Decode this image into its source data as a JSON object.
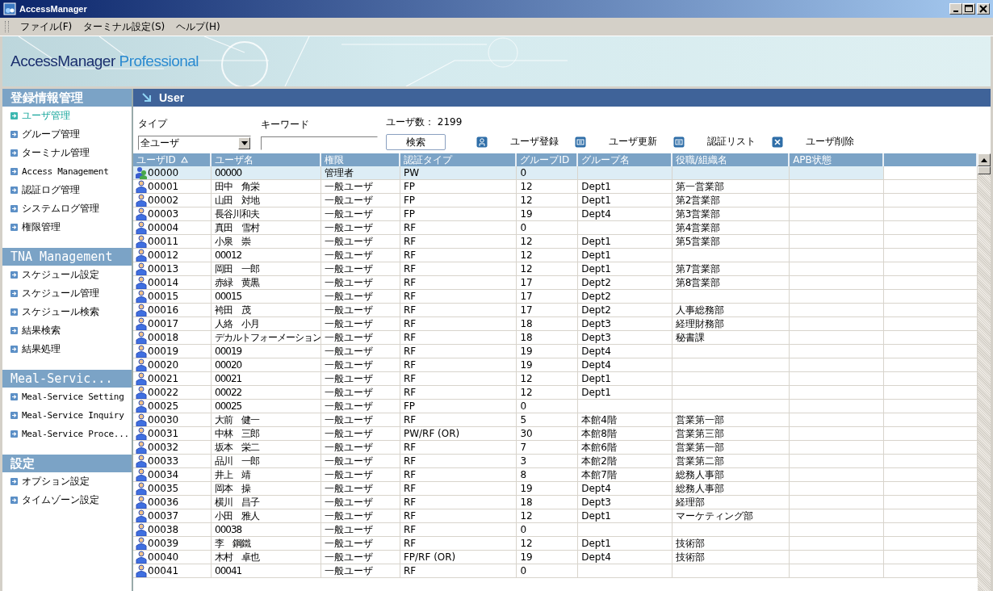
{
  "window": {
    "title": "AccessManager"
  },
  "menu": [
    {
      "label": "ファイル(F)"
    },
    {
      "label": "ターミナル設定(S)"
    },
    {
      "label": "ヘルプ(H)"
    }
  ],
  "banner": {
    "brand": "AccessManager",
    "product": "Professional"
  },
  "sidebar": [
    {
      "title": "登録情報管理",
      "items": [
        {
          "label": "ユーザ管理",
          "selected": true
        },
        {
          "label": "グループ管理",
          "selected": false
        },
        {
          "label": "ターミナル管理",
          "selected": false
        },
        {
          "label": "Access Management",
          "selected": false
        },
        {
          "label": "認証ログ管理",
          "selected": false
        },
        {
          "label": "システムログ管理",
          "selected": false
        },
        {
          "label": "権限管理",
          "selected": false
        }
      ]
    },
    {
      "title": "TNA Management",
      "items": [
        {
          "label": "スケジュール設定",
          "selected": false
        },
        {
          "label": "スケジュール管理",
          "selected": false
        },
        {
          "label": "スケジュール検索",
          "selected": false
        },
        {
          "label": "結果検索",
          "selected": false
        },
        {
          "label": "結果処理",
          "selected": false
        }
      ]
    },
    {
      "title": "Meal-Servic...",
      "items": [
        {
          "label": "Meal-Service Setting",
          "selected": false
        },
        {
          "label": "Meal-Service Inquiry",
          "selected": false
        },
        {
          "label": "Meal-Service Proce...",
          "selected": false
        }
      ]
    },
    {
      "title": "設定",
      "items": [
        {
          "label": "オプション設定",
          "selected": false
        },
        {
          "label": "タイムゾーン設定",
          "selected": false
        }
      ]
    }
  ],
  "panel": {
    "title": "User"
  },
  "filters": {
    "type_label": "タイプ",
    "type_value": "全ユーザ",
    "keyword_label": "キーワード",
    "count_label": "ユーザ数：",
    "count": "2199",
    "search_button": "検索"
  },
  "actions": [
    {
      "kind": "add",
      "label": "ユーザ登録"
    },
    {
      "kind": "update",
      "label": "ユーザ更新"
    },
    {
      "kind": "list",
      "label": "認証リスト"
    },
    {
      "kind": "delete",
      "label": "ユーザ削除"
    }
  ],
  "table": {
    "columns": [
      {
        "label": "ユーザID",
        "sorted": true
      },
      {
        "label": "ユーザ名",
        "sorted": false
      },
      {
        "label": "権限",
        "sorted": false
      },
      {
        "label": "認証タイプ",
        "sorted": false
      },
      {
        "label": "グループID",
        "sorted": false
      },
      {
        "label": "グループ名",
        "sorted": false
      },
      {
        "label": "役職/組織名",
        "sorted": false
      },
      {
        "label": "APB状態",
        "sorted": false
      }
    ],
    "rows": [
      {
        "kind": "admin",
        "selected": true,
        "cells": [
          "00000",
          "00000",
          "管理者",
          "PW",
          "0",
          "",
          ""
        ]
      },
      {
        "kind": "user",
        "selected": false,
        "cells": [
          "00001",
          "田中　角栄",
          "一般ユーザ",
          "FP",
          "12",
          "Dept1",
          "第一営業部"
        ]
      },
      {
        "kind": "user",
        "selected": false,
        "cells": [
          "00002",
          "山田　対地",
          "一般ユーザ",
          "FP",
          "12",
          "Dept1",
          "第2営業部"
        ]
      },
      {
        "kind": "user",
        "selected": false,
        "cells": [
          "00003",
          "長谷川和夫",
          "一般ユーザ",
          "FP",
          "19",
          "Dept4",
          "第3営業部"
        ]
      },
      {
        "kind": "user",
        "selected": false,
        "cells": [
          "00004",
          "真田　雪村",
          "一般ユーザ",
          "RF",
          "0",
          "",
          "第4営業部"
        ]
      },
      {
        "kind": "user",
        "selected": false,
        "cells": [
          "00011",
          "小泉　崇",
          "一般ユーザ",
          "RF",
          "12",
          "Dept1",
          "第5営業部"
        ]
      },
      {
        "kind": "user",
        "selected": false,
        "cells": [
          "00012",
          "00012",
          "一般ユーザ",
          "RF",
          "12",
          "Dept1",
          ""
        ]
      },
      {
        "kind": "user",
        "selected": false,
        "cells": [
          "00013",
          "岡田　一郎",
          "一般ユーザ",
          "RF",
          "12",
          "Dept1",
          "第7営業部"
        ]
      },
      {
        "kind": "user",
        "selected": false,
        "cells": [
          "00014",
          "赤緑　黄黒",
          "一般ユーザ",
          "RF",
          "17",
          "Dept2",
          "第8営業部"
        ]
      },
      {
        "kind": "user",
        "selected": false,
        "cells": [
          "00015",
          "00015",
          "一般ユーザ",
          "RF",
          "17",
          "Dept2",
          ""
        ]
      },
      {
        "kind": "user",
        "selected": false,
        "cells": [
          "00016",
          "袴田　茂",
          "一般ユーザ",
          "RF",
          "17",
          "Dept2",
          "人事総務部"
        ]
      },
      {
        "kind": "user",
        "selected": false,
        "cells": [
          "00017",
          "人絡　小月",
          "一般ユーザ",
          "RF",
          "18",
          "Dept3",
          "経理財務部"
        ]
      },
      {
        "kind": "user",
        "selected": false,
        "cells": [
          "00018",
          "デカルトフォーメーション",
          "一般ユーザ",
          "RF",
          "18",
          "Dept3",
          "秘書課"
        ]
      },
      {
        "kind": "user",
        "selected": false,
        "cells": [
          "00019",
          "00019",
          "一般ユーザ",
          "RF",
          "19",
          "Dept4",
          ""
        ]
      },
      {
        "kind": "user",
        "selected": false,
        "cells": [
          "00020",
          "00020",
          "一般ユーザ",
          "RF",
          "19",
          "Dept4",
          ""
        ]
      },
      {
        "kind": "user",
        "selected": false,
        "cells": [
          "00021",
          "00021",
          "一般ユーザ",
          "RF",
          "12",
          "Dept1",
          ""
        ]
      },
      {
        "kind": "user",
        "selected": false,
        "cells": [
          "00022",
          "00022",
          "一般ユーザ",
          "RF",
          "12",
          "Dept1",
          ""
        ]
      },
      {
        "kind": "user",
        "selected": false,
        "cells": [
          "00025",
          "00025",
          "一般ユーザ",
          "FP",
          "0",
          "",
          ""
        ]
      },
      {
        "kind": "user",
        "selected": false,
        "cells": [
          "00030",
          "大前　健一",
          "一般ユーザ",
          "RF",
          "5",
          "本館4階",
          "営業第一部"
        ]
      },
      {
        "kind": "user",
        "selected": false,
        "cells": [
          "00031",
          "中林　三郎",
          "一般ユーザ",
          "PW/RF (OR)",
          "30",
          "本館8階",
          "営業第三部"
        ]
      },
      {
        "kind": "user",
        "selected": false,
        "cells": [
          "00032",
          "坂本　栄二",
          "一般ユーザ",
          "RF",
          "7",
          "本館6階",
          "営業第一部"
        ]
      },
      {
        "kind": "user",
        "selected": false,
        "cells": [
          "00033",
          "品川　一郎",
          "一般ユーザ",
          "RF",
          "3",
          "本館2階",
          "営業第二部"
        ]
      },
      {
        "kind": "user",
        "selected": false,
        "cells": [
          "00034",
          "井上　靖",
          "一般ユーザ",
          "RF",
          "8",
          "本館7階",
          "総務人事部"
        ]
      },
      {
        "kind": "user",
        "selected": false,
        "cells": [
          "00035",
          "岡本　操",
          "一般ユーザ",
          "RF",
          "19",
          "Dept4",
          "総務人事部"
        ]
      },
      {
        "kind": "user",
        "selected": false,
        "cells": [
          "00036",
          "横川　昌子",
          "一般ユーザ",
          "RF",
          "18",
          "Dept3",
          "経理部"
        ]
      },
      {
        "kind": "user",
        "selected": false,
        "cells": [
          "00037",
          "小田　雅人",
          "一般ユーザ",
          "RF",
          "12",
          "Dept1",
          "マーケティング部"
        ]
      },
      {
        "kind": "user",
        "selected": false,
        "cells": [
          "00038",
          "00038",
          "一般ユーザ",
          "RF",
          "0",
          "",
          ""
        ]
      },
      {
        "kind": "user",
        "selected": false,
        "cells": [
          "00039",
          "李　鋼鐵",
          "一般ユーザ",
          "RF",
          "12",
          "Dept1",
          "技術部"
        ]
      },
      {
        "kind": "user",
        "selected": false,
        "cells": [
          "00040",
          "木村　卓也",
          "一般ユーザ",
          "FP/RF (OR)",
          "19",
          "Dept4",
          "技術部"
        ]
      },
      {
        "kind": "user",
        "selected": false,
        "cells": [
          "00041",
          "00041",
          "一般ユーザ",
          "RF",
          "0",
          "",
          ""
        ]
      }
    ]
  }
}
